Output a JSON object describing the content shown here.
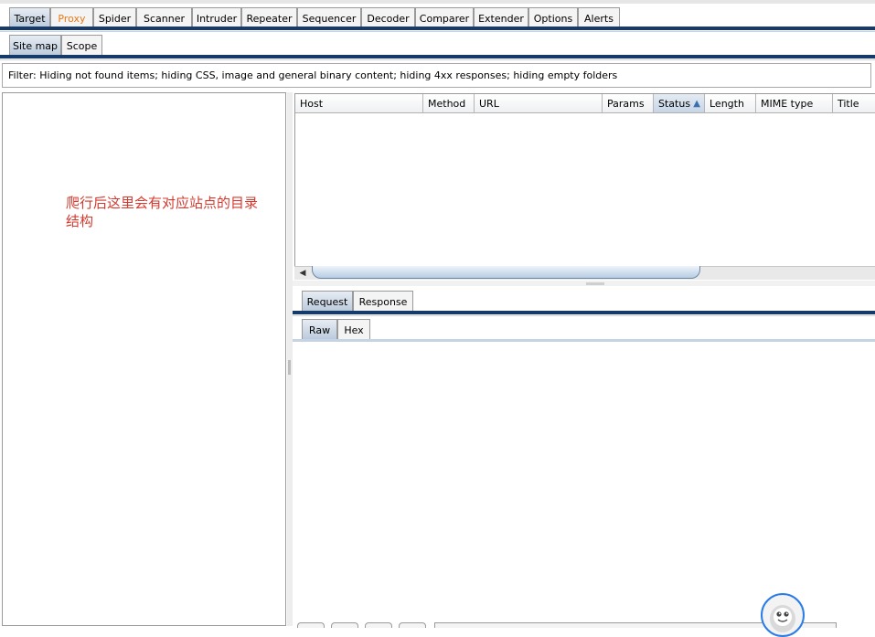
{
  "top_tabs": [
    {
      "label": "Target",
      "selected": true
    },
    {
      "label": "Proxy",
      "highlighted": true
    },
    {
      "label": "Spider"
    },
    {
      "label": "Scanner"
    },
    {
      "label": "Intruder"
    },
    {
      "label": "Repeater"
    },
    {
      "label": "Sequencer"
    },
    {
      "label": "Decoder"
    },
    {
      "label": "Comparer"
    },
    {
      "label": "Extender"
    },
    {
      "label": "Options"
    },
    {
      "label": "Alerts"
    }
  ],
  "sub_tabs": [
    {
      "label": "Site map",
      "selected": true
    },
    {
      "label": "Scope"
    }
  ],
  "filter": {
    "text": "Filter:  Hiding not found items;  hiding CSS, image and general binary content;  hiding 4xx responses;  hiding empty folders"
  },
  "annotation": {
    "text": "爬行后这里会有对应站点的目录结构"
  },
  "table": {
    "columns": [
      "Host",
      "Method",
      "URL",
      "Params",
      "Status",
      "Length",
      "MIME type",
      "Title"
    ],
    "sorted_column": "Status",
    "sort_arrow": "▲",
    "rows": []
  },
  "message_tabs": [
    {
      "label": "Request",
      "selected": true
    },
    {
      "label": "Response"
    }
  ],
  "view_tabs": [
    {
      "label": "Raw",
      "selected": true
    },
    {
      "label": "Hex"
    }
  ],
  "scroll": {
    "left_arrow": "◀"
  },
  "colors": {
    "tab_highlight": "#e57a14",
    "rule": "#163a6a",
    "annotation": "#d43a2f",
    "avatar_ring": "#2a7ce6"
  }
}
